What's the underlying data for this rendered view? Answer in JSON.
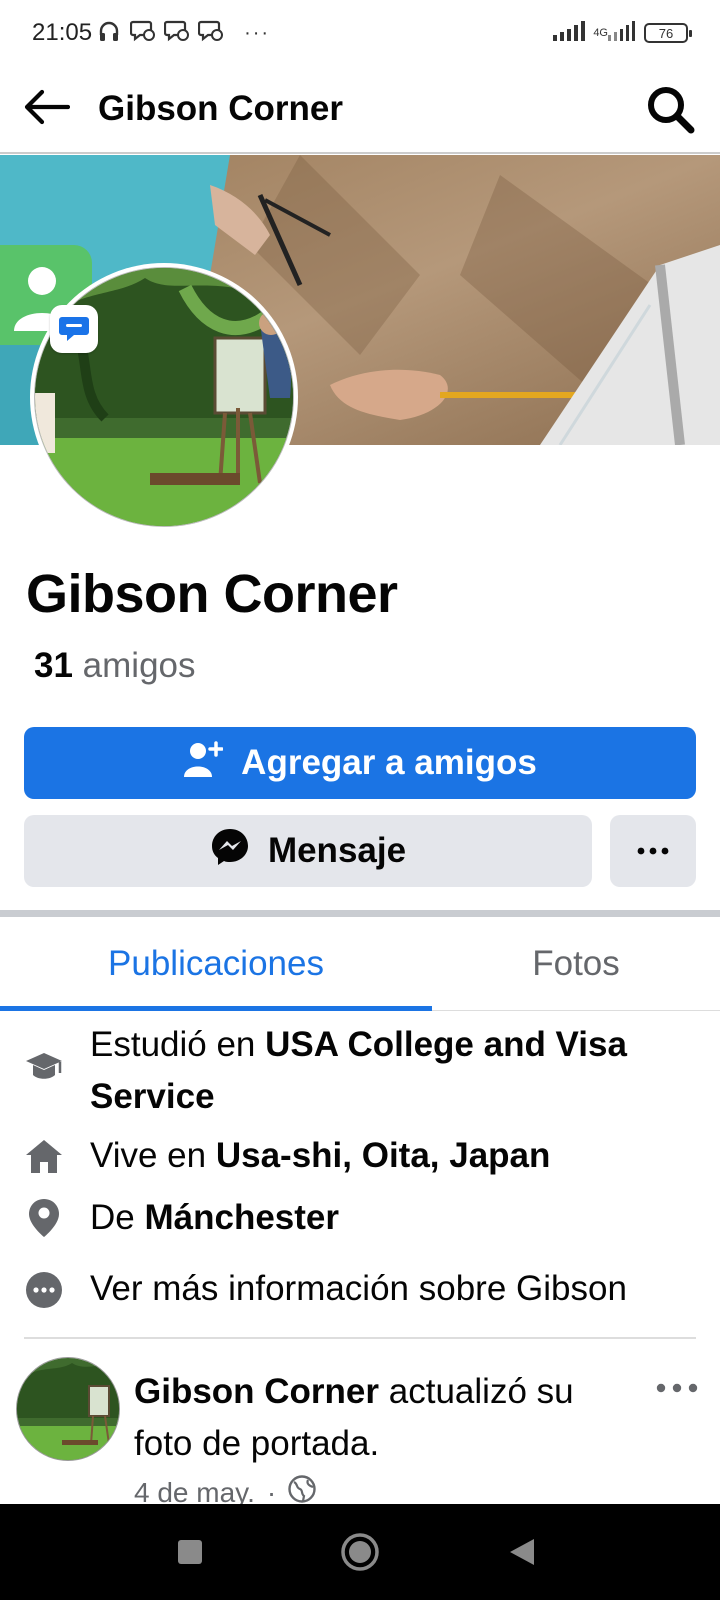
{
  "status_bar": {
    "time": "21:05",
    "ellipsis": "···",
    "network_label": "4G",
    "battery": "76"
  },
  "header": {
    "title": "Gibson Corner"
  },
  "profile": {
    "name": "Gibson Corner",
    "friends_count": "31",
    "friends_label": "amigos"
  },
  "actions": {
    "add_friend_label": "Agregar a amigos",
    "message_label": "Mensaje",
    "more_label": "···"
  },
  "tabs": [
    {
      "label": "Publicaciones",
      "active": true
    },
    {
      "label": "Fotos",
      "active": false
    }
  ],
  "about": {
    "studied_prefix": "Estudió en",
    "studied_at": "USA College and Visa Service",
    "lives_prefix": "Vive en",
    "lives_in": "Usa-shi, Oita, Japan",
    "from_prefix": "De",
    "from": "Mánchester",
    "see_more": "Ver más información sobre Gibson"
  },
  "post": {
    "author": "Gibson Corner",
    "action_text": "actualizó su foto de portada.",
    "date": "4 de may.",
    "separator": "·"
  },
  "colors": {
    "primary": "#1b74e4",
    "secondary_button": "#e4e6eb",
    "muted_text": "#65676b"
  }
}
